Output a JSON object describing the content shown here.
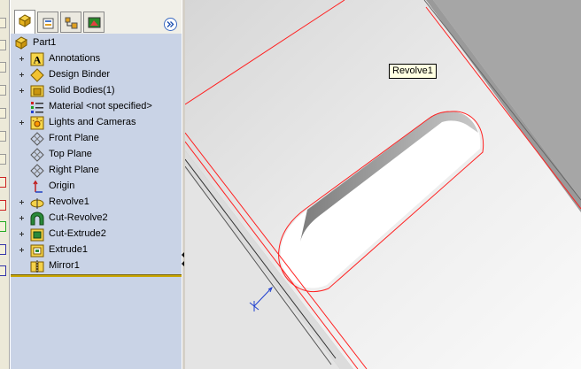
{
  "window": {
    "feature_manager": "FeatureManager Design Tree"
  },
  "tabs": [
    {
      "name": "feature-manager-tab",
      "active": true
    },
    {
      "name": "property-manager-tab",
      "active": false
    },
    {
      "name": "configuration-manager-tab",
      "active": false
    },
    {
      "name": "dim-xpert-manager-tab",
      "active": false
    }
  ],
  "tree": {
    "root": "Part1",
    "items": [
      {
        "label": "Annotations",
        "expand": true,
        "icon": "annotations-icon"
      },
      {
        "label": "Design Binder",
        "expand": true,
        "icon": "design-binder-icon"
      },
      {
        "label": "Solid Bodies(1)",
        "expand": true,
        "icon": "solid-bodies-icon"
      },
      {
        "label": "Material <not specified>",
        "expand": false,
        "icon": "material-icon"
      },
      {
        "label": "Lights and Cameras",
        "expand": true,
        "icon": "lights-cameras-icon"
      },
      {
        "label": "Front Plane",
        "expand": false,
        "icon": "plane-icon"
      },
      {
        "label": "Top Plane",
        "expand": false,
        "icon": "plane-icon"
      },
      {
        "label": "Right Plane",
        "expand": false,
        "icon": "plane-icon"
      },
      {
        "label": "Origin",
        "expand": false,
        "icon": "origin-icon"
      },
      {
        "label": "Revolve1",
        "expand": true,
        "icon": "revolve-icon"
      },
      {
        "label": "Cut-Revolve2",
        "expand": true,
        "icon": "cut-revolve-icon"
      },
      {
        "label": "Cut-Extrude2",
        "expand": true,
        "icon": "cut-extrude-icon"
      },
      {
        "label": "Extrude1",
        "expand": true,
        "icon": "extrude-icon"
      },
      {
        "label": "Mirror1",
        "expand": false,
        "icon": "mirror-icon"
      }
    ]
  },
  "viewport": {
    "tooltip": "Revolve1"
  },
  "colors": {
    "panel_bg": "#c9d3e6",
    "highlight_edge": "#ff0000",
    "rollback_bar": "#c9a600",
    "tooltip_bg": "#ffffe1"
  }
}
